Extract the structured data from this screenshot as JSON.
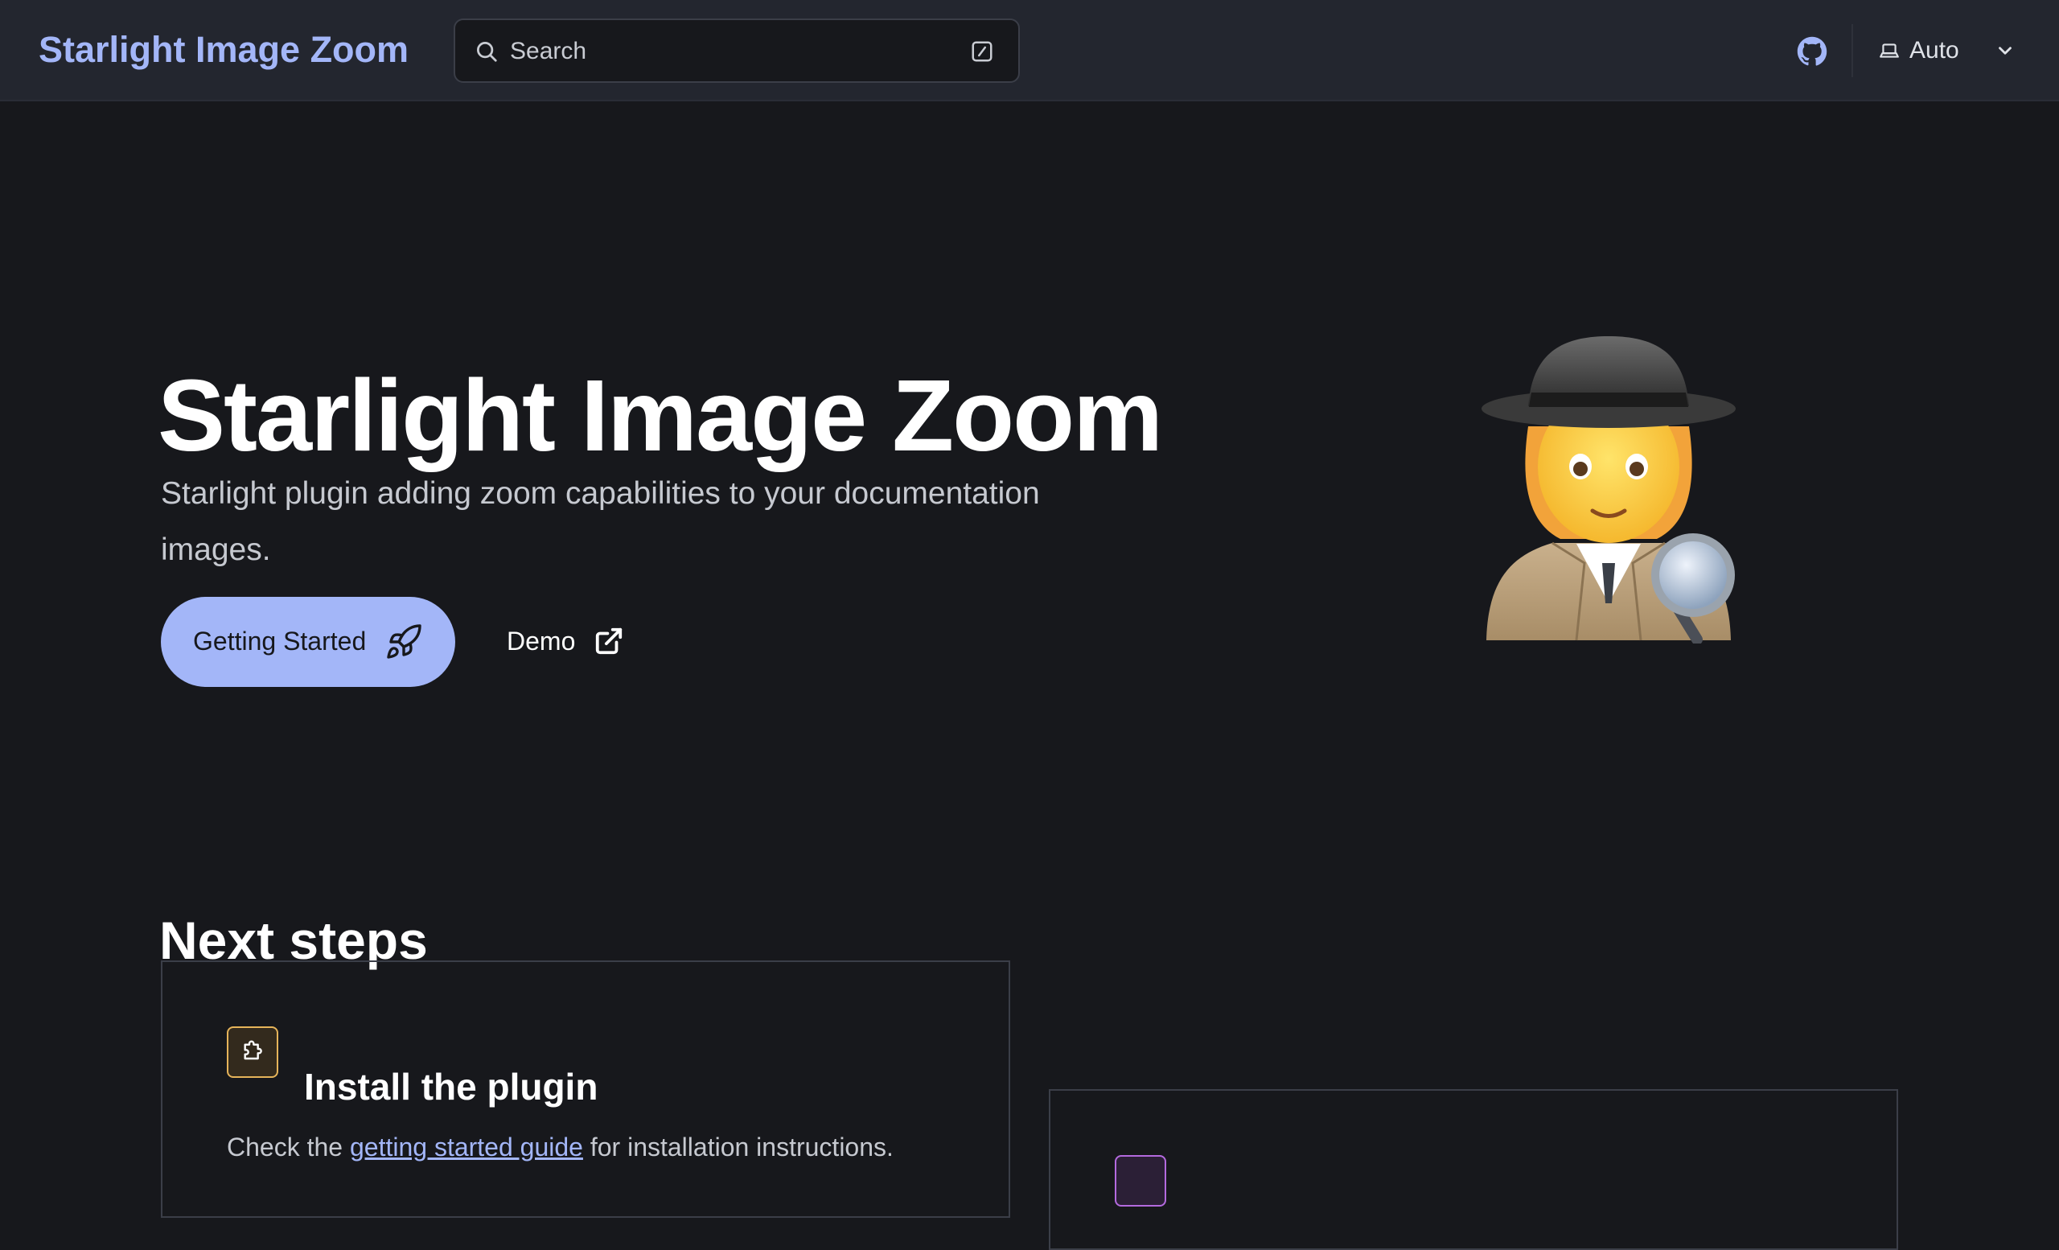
{
  "header": {
    "site_title": "Starlight Image Zoom",
    "search": {
      "placeholder": "Search"
    },
    "theme": {
      "selected": "Auto"
    }
  },
  "hero": {
    "title": "Starlight Image Zoom",
    "tagline": "Starlight plugin adding zoom capabilities to your documentation images.",
    "actions": {
      "primary_label": "Getting Started",
      "secondary_label": "Demo"
    }
  },
  "next_steps": {
    "title": "Next steps",
    "cards": [
      {
        "title": "Install the plugin",
        "body_prefix": "Check the ",
        "link_text": "getting started guide",
        "body_suffix": " for installation instructions.",
        "icon": "puzzle-icon"
      },
      {
        "title": "",
        "icon": "card-icon"
      }
    ]
  },
  "colors": {
    "accent": "#a3b6f8",
    "background": "#17181c",
    "header": "#23262f",
    "card_border": "#3b3e48",
    "orange_icon": "#e6b45a",
    "purple_icon": "#b46adf"
  },
  "icons": {
    "search": "search-icon",
    "keyboard_shortcut": "slash-key-icon",
    "github": "github-icon",
    "theme": "laptop-icon",
    "chevron": "chevron-down-icon",
    "rocket": "rocket-icon",
    "external": "external-link-icon",
    "hero_image": "detective-illustration"
  }
}
